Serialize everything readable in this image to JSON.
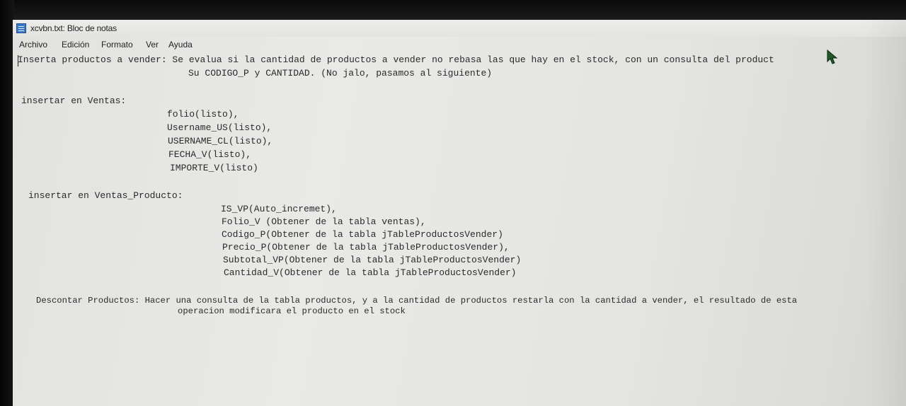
{
  "window": {
    "title": "xcvbn.txt: Bloc de notas"
  },
  "menu": [
    "Archivo",
    "Edición",
    "Formato",
    "Ver",
    "Ayuda"
  ],
  "editor": {
    "lines": [
      "Inserta productos a vender: Se evalua si la cantidad de productos a vender no rebasa las que hay en el stock, con un consulta del product",
      "Su CODIGO_P y CANTIDAD. (No jalo, pasamos al siguiente)",
      "insertar en Ventas:",
      "folio(listo),",
      "Username_US(listo),",
      "USERNAME_CL(listo),",
      "FECHA_V(listo),",
      "IMPORTE_V(listo)",
      "insertar en Ventas_Producto:",
      "IS_VP(Auto_incremet),",
      "Folio_V (Obtener de la tabla ventas),",
      "Codigo_P(Obtener de la tabla jTableProductosVender)",
      "Precio_P(Obtener de la tabla jTableProductosVender),",
      "Subtotal_VP(Obtener de la tabla jTableProductosVender)",
      "Cantidad_V(Obtener de la tabla jTableProductosVender)",
      "Descontar Productos: Hacer una consulta de la tabla productos, y a la cantidad de productos restarla con la cantidad a vender, el resultado de esta",
      "operacion modificara el producto en el stock"
    ]
  }
}
